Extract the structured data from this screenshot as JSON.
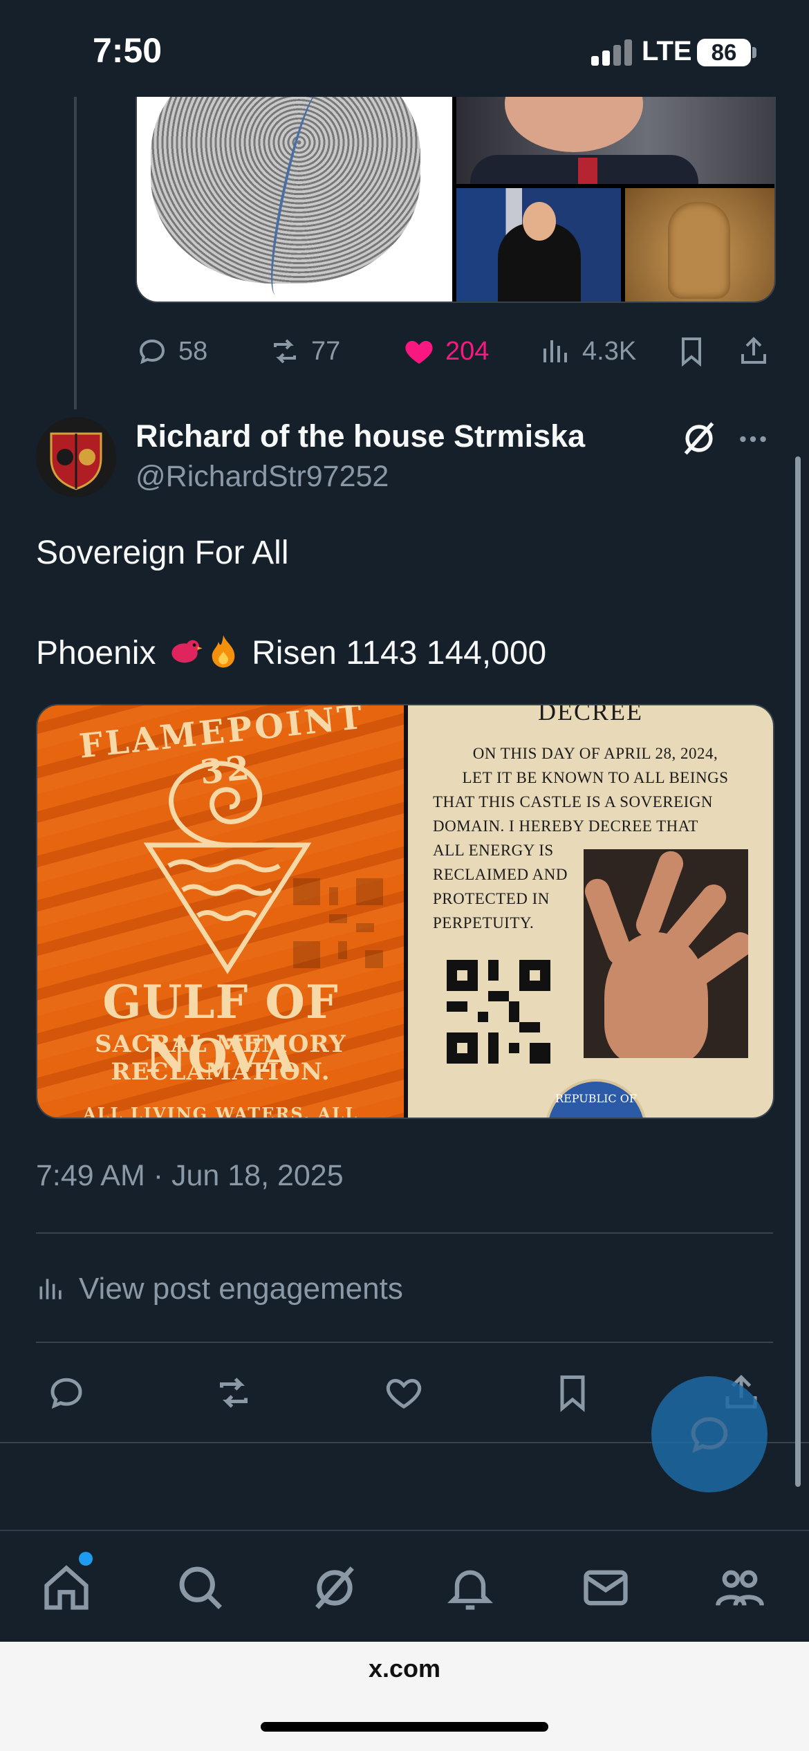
{
  "status_bar": {
    "time": "7:50",
    "network": "LTE",
    "battery": "86"
  },
  "prev_tweet": {
    "actions": {
      "replies": "58",
      "reposts": "77",
      "likes": "204",
      "views": "4.3K"
    }
  },
  "tweet": {
    "display_name": "Richard of the house Strmiska",
    "handle": "@RichardStr97252",
    "line1": "Sovereign For All",
    "line2_before": "Phoenix ",
    "line2_emojis": [
      "bird-emoji",
      "fire-emoji"
    ],
    "line2_after": " Risen 1143 144,000",
    "timestamp": "7:49 AM · Jun 18, 2025",
    "engagements_label": "View post engagements",
    "media": {
      "left_image": {
        "arc_text": "FLAMEPOINT 32",
        "title": "GULF OF NOVA",
        "subtitle_1": "SACRAL MEMORY",
        "subtitle_2": "RECLAMATION.",
        "footer": "ALL LIVING WATERS, ALL"
      },
      "right_image": {
        "title": "DECREE",
        "body_lines": [
          "ON THIS DAY OF APRIL 28, 2024,",
          "LET IT BE KNOWN TO ALL BEINGS",
          "THAT THIS CASTLE IS A SOVEREIGN",
          "DOMAIN. I HEREBY DECREE THAT",
          "ALL ENERGY IS",
          "RECLAIMED AND",
          "PROTECTED IN",
          "PERPETUITY."
        ],
        "seal_text": "REPUBLIC OF"
      }
    }
  },
  "tab_bar": [
    "home-icon",
    "search-icon",
    "grok-icon",
    "notifications-icon",
    "messages-icon",
    "communities-icon"
  ],
  "browser": {
    "url": "x.com"
  },
  "colors": {
    "background": "#15202b",
    "muted": "#8b98a5",
    "like": "#f91880",
    "accent": "#1d9bf0"
  }
}
